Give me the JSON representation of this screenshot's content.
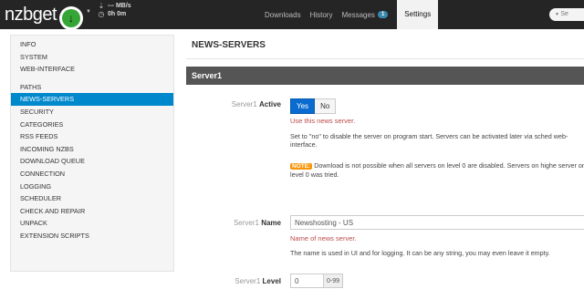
{
  "header": {
    "logo": "nzbget",
    "speed": "--- MB/s",
    "time": "0h 0m",
    "nav": [
      {
        "label": "Downloads"
      },
      {
        "label": "History"
      },
      {
        "label": "Messages",
        "badge": "1"
      },
      {
        "label": "Settings",
        "active": true
      }
    ],
    "search_placeholder": "Se"
  },
  "sidebar": {
    "items": [
      "INFO",
      "SYSTEM",
      "WEB-INTERFACE",
      "PATHS",
      "NEWS-SERVERS",
      "SECURITY",
      "CATEGORIES",
      "RSS FEEDS",
      "INCOMING NZBS",
      "DOWNLOAD QUEUE",
      "CONNECTION",
      "LOGGING",
      "SCHEDULER",
      "CHECK AND REPAIR",
      "UNPACK",
      "EXTENSION SCRIPTS"
    ],
    "active": "NEWS-SERVERS"
  },
  "main": {
    "title": "NEWS-SERVERS",
    "section": "Server1",
    "fields": {
      "active": {
        "prefix": "Server1",
        "label": "Active",
        "yes": "Yes",
        "no": "No",
        "hint": "Use this news server.",
        "desc1": "Set to \"no\" to disable the server on program start. Servers can be activated later via sched web-interface.",
        "note_label": "NOTE:",
        "note_text": "Download is not possible when all servers on level 0 are disabled. Servers on highe server on level 0 was tried."
      },
      "name": {
        "prefix": "Server1",
        "label": "Name",
        "value": "Newshosting - US",
        "hint": "Name of news server.",
        "desc": "The name is used in UI and for logging. It can be any string, you may even leave it empty."
      },
      "level": {
        "prefix": "Server1",
        "label": "Level",
        "value": "0",
        "addon": "0-99"
      }
    }
  }
}
